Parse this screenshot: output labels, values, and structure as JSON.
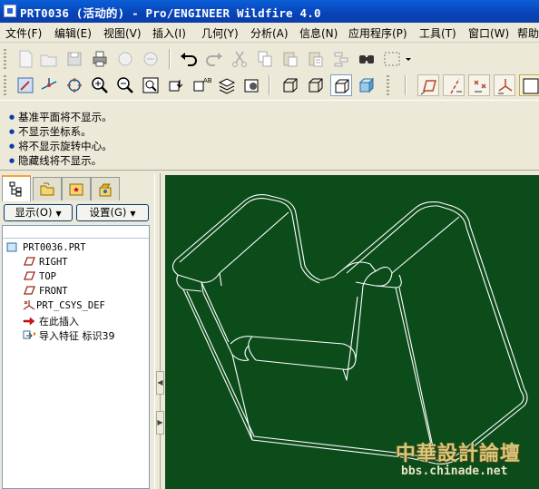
{
  "window": {
    "title": "PRT0036 (活动的) - Pro/ENGINEER Wildfire 4.0"
  },
  "menu": [
    {
      "label": "文件(F)"
    },
    {
      "label": "编辑(E)"
    },
    {
      "label": "视图(V)"
    },
    {
      "label": "插入(I)"
    },
    {
      "label": "几何(Y)"
    },
    {
      "label": "分析(A)"
    },
    {
      "label": "信息(N)"
    },
    {
      "label": "应用程序(P)"
    },
    {
      "label": "工具(T)"
    },
    {
      "label": "窗口(W)"
    },
    {
      "label": "帮助"
    }
  ],
  "toolbar1": [
    "new-icon",
    "open-icon",
    "save-icon",
    "print-icon",
    "send-icon",
    "mapkey-icon",
    "undo-icon",
    "redo-icon",
    "cut-icon",
    "copy-icon",
    "paste-icon",
    "paste-special-icon",
    "regenerate-icon",
    "find-icon",
    "select-box-icon"
  ],
  "toolbar2": [
    "repaint-icon",
    "spin-center-icon",
    "orient-icon",
    "zoom-in-icon",
    "zoom-out-icon",
    "refit-icon",
    "view-manager-icon",
    "saved-views-icon",
    "layers-icon",
    "appearance-icon",
    "wireframe-icon",
    "hidden-line-icon",
    "no-hidden-icon",
    "shading-icon",
    "datum-planes-icon",
    "datum-axes-icon",
    "datum-points-icon",
    "coord-sys-icon"
  ],
  "messages": [
    "基准平面将不显示。",
    "不显示坐标系。",
    "将不显示旋转中心。",
    "隐藏线将不显示。"
  ],
  "navigator": {
    "tabs": [
      "model-tree-tab-icon",
      "folder-tab-icon",
      "favorites-tab-icon",
      "connections-tab-icon"
    ],
    "show_button": "显示(O)",
    "settings_button": "设置(G)"
  },
  "tree": {
    "root": "PRT0036.PRT",
    "items": [
      {
        "label": "RIGHT",
        "icon": "datum-plane-icon"
      },
      {
        "label": "TOP",
        "icon": "datum-plane-icon"
      },
      {
        "label": "FRONT",
        "icon": "datum-plane-icon"
      },
      {
        "label": "PRT_CSYS_DEF",
        "icon": "csys-icon"
      },
      {
        "label": "在此插入",
        "icon": "insert-here-arrow-icon"
      },
      {
        "label": "导入特征 标识39",
        "icon": "import-feature-icon"
      }
    ]
  },
  "watermark": {
    "title": "中華設計論壇",
    "url": "bbs.chinade.net"
  },
  "colors": {
    "viewport_bg": "#0c4c1b",
    "title_bar": "#0843b8",
    "model_edges": "#ffffff"
  }
}
